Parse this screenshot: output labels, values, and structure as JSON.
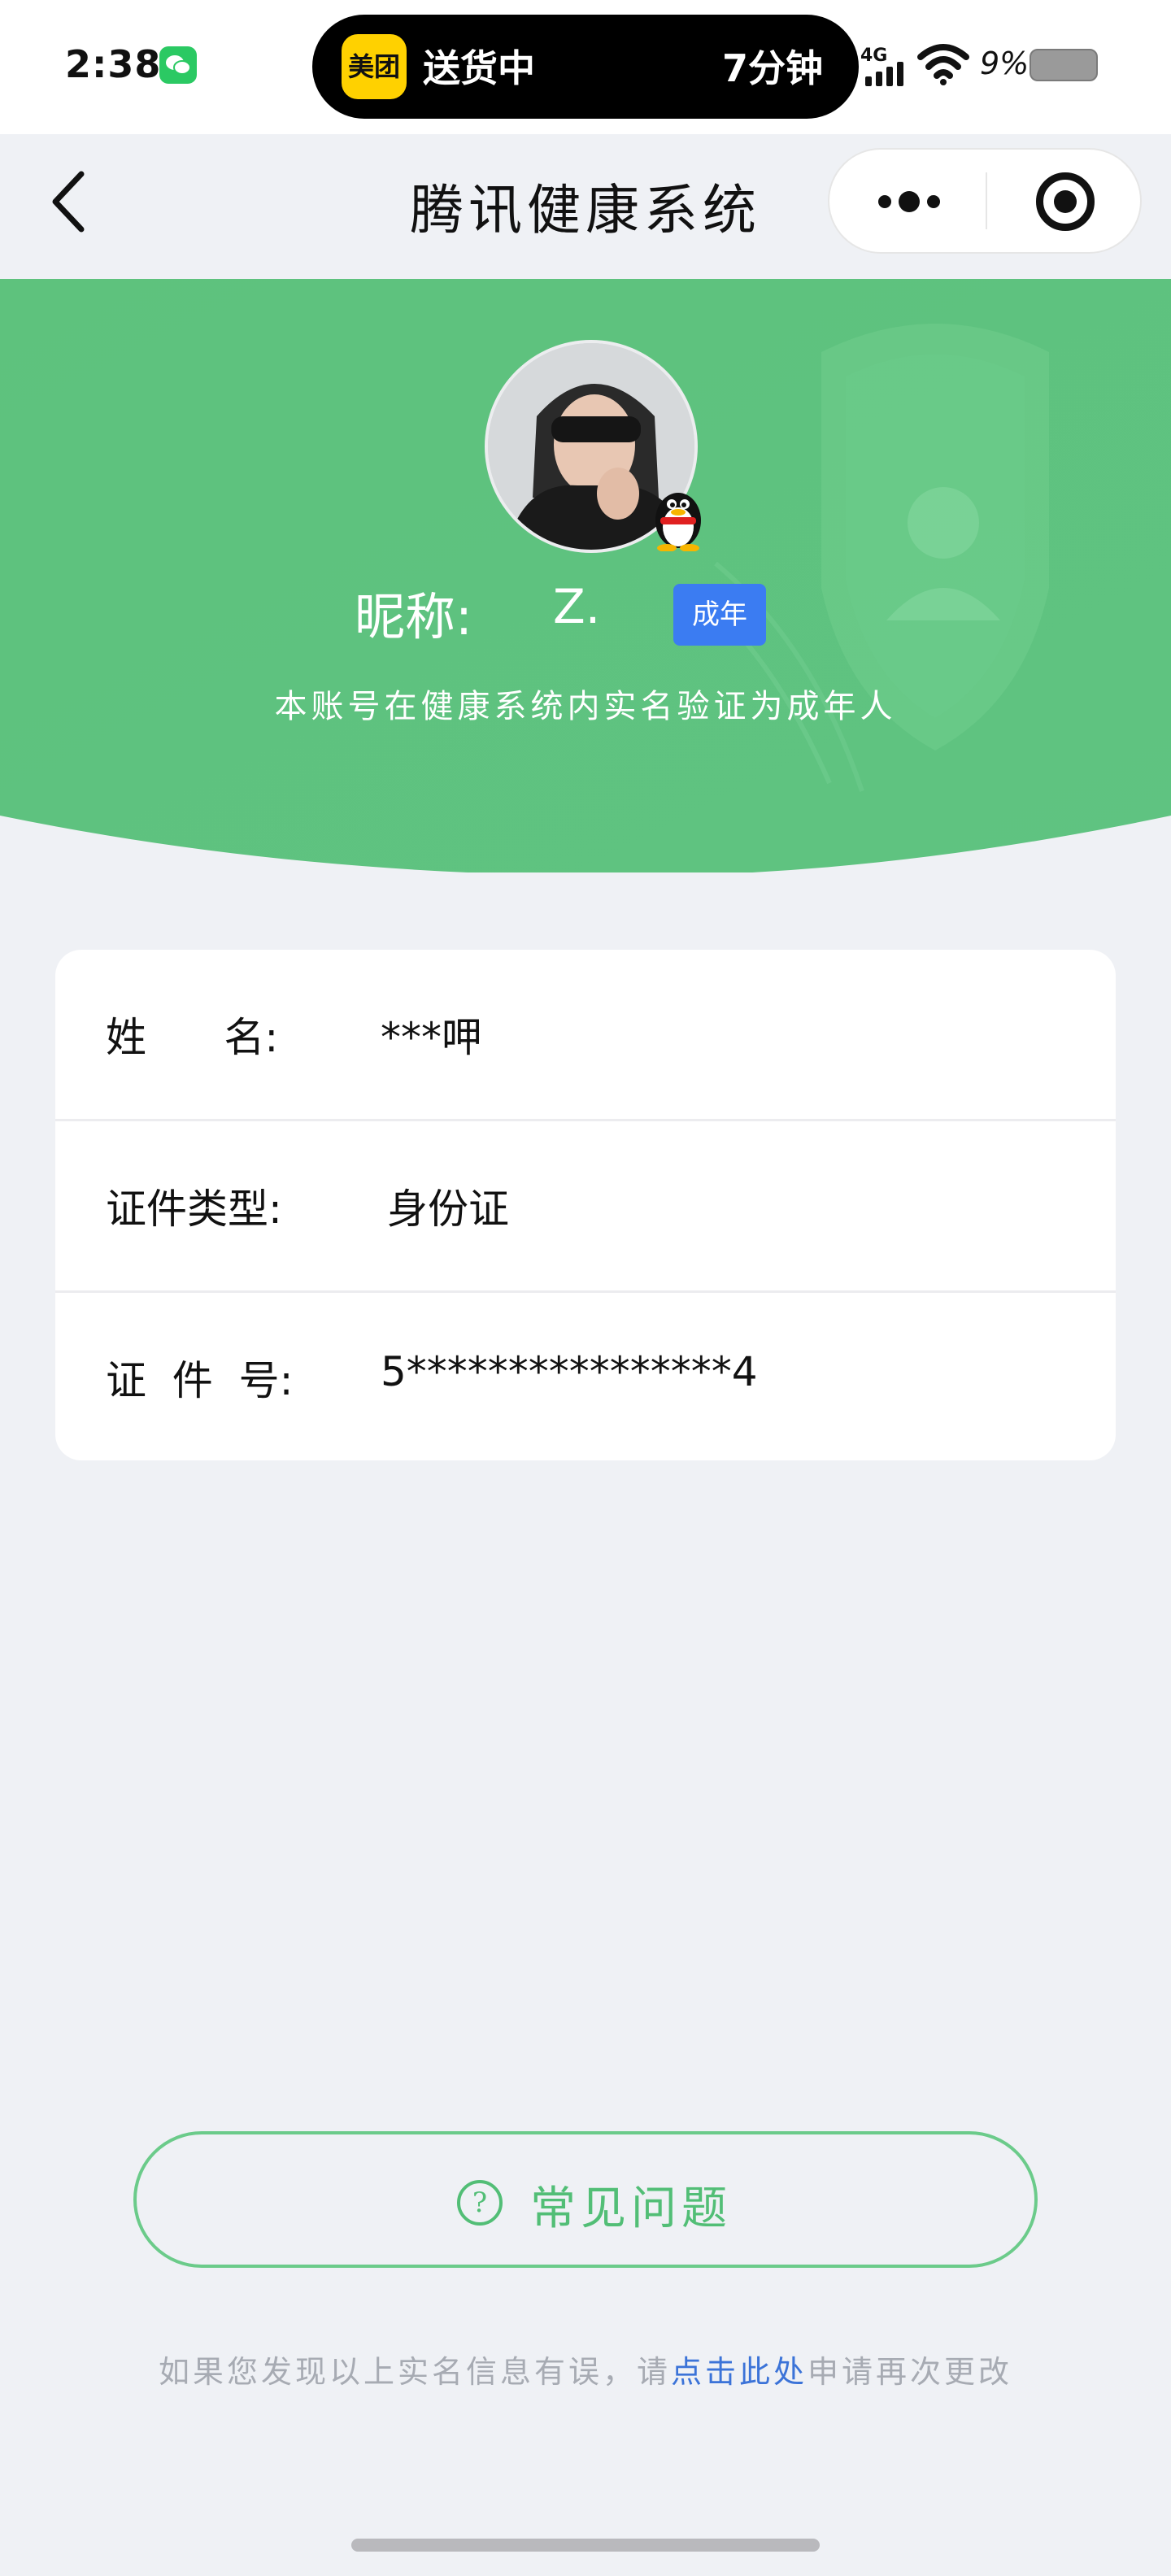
{
  "status_bar": {
    "time": "2:38",
    "island_app": "美团",
    "island_status": "送货中",
    "island_eta": "7分钟",
    "network": "4G",
    "battery": "9%"
  },
  "nav": {
    "title": "腾讯健康系统"
  },
  "profile": {
    "nickname_label": "昵称:",
    "nickname_value": "Z.",
    "age_badge": "成年",
    "verification_note": "本账号在健康系统内实名验证为成年人"
  },
  "info": {
    "rows": [
      {
        "label": "姓      名:",
        "value": "***呷"
      },
      {
        "label": "证件类型:",
        "value": "身份证"
      },
      {
        "label": "证  件  号:",
        "value": "5****************4"
      }
    ]
  },
  "faq": {
    "icon": "?",
    "label": "常见问题"
  },
  "footer": {
    "prefix": "如果您发现以上实名信息有误，请",
    "link": "点击此处",
    "suffix": "申请再次更改"
  },
  "colors": {
    "brand_green": "#5cc07a",
    "badge_blue": "#3b7cf2",
    "link_blue": "#3b73d8",
    "page_bg": "#eff1f5"
  }
}
